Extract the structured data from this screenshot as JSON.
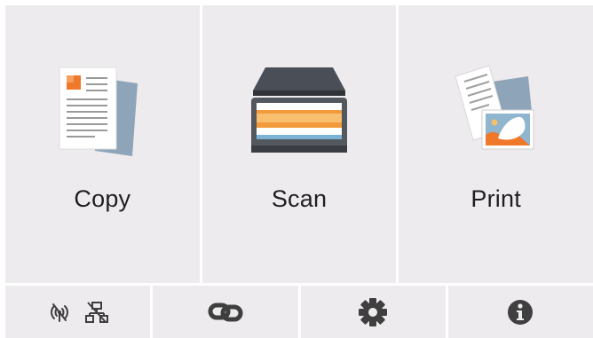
{
  "tiles": [
    {
      "label": "Copy",
      "icon": "copy-document-icon"
    },
    {
      "label": "Scan",
      "icon": "flatbed-scanner-icon"
    },
    {
      "label": "Print",
      "icon": "print-photo-icon"
    }
  ],
  "toolbar": [
    {
      "icons": [
        "wireless-off-icon",
        "wired-lan-off-icon"
      ]
    },
    {
      "icons": [
        "link-icon"
      ]
    },
    {
      "icons": [
        "gear-icon"
      ]
    },
    {
      "icons": [
        "info-icon"
      ]
    }
  ],
  "colors": {
    "tile_bg": "#eeebee",
    "icon_dark": "#3f3f3f",
    "accent_orange": "#f0782a"
  }
}
